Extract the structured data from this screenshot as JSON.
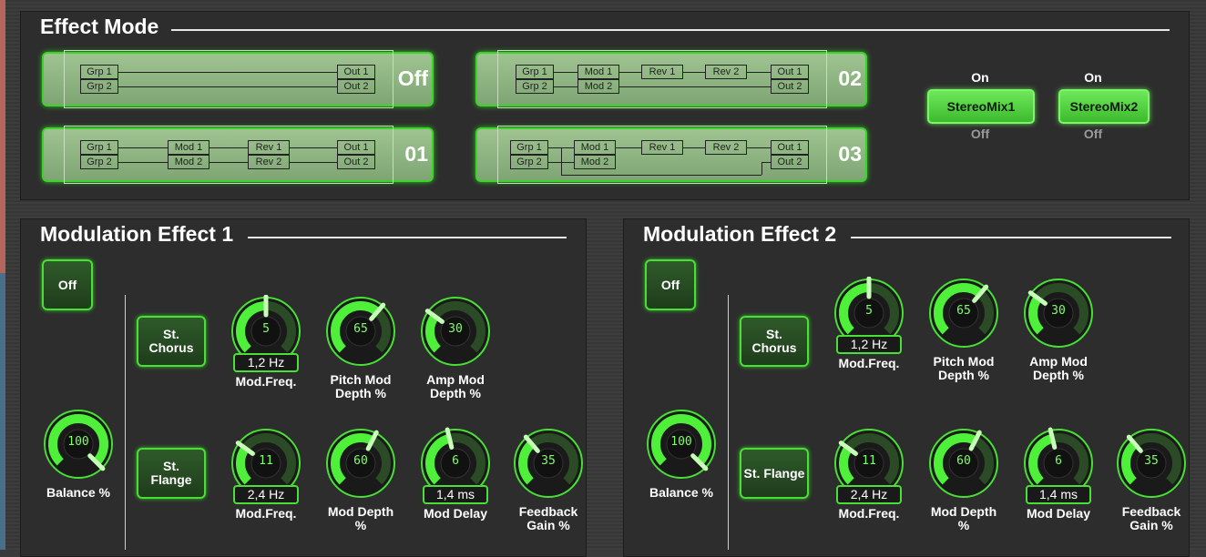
{
  "effect_mode": {
    "title": "Effect Mode",
    "routes": [
      {
        "id": "off",
        "label": "Off"
      },
      {
        "id": "02",
        "label": "02"
      },
      {
        "id": "01",
        "label": "01"
      },
      {
        "id": "03",
        "label": "03"
      }
    ],
    "box_labels": {
      "grp1": "Grp 1",
      "grp2": "Grp 2",
      "out1": "Out 1",
      "out2": "Out 2",
      "mod1": "Mod 1",
      "mod2": "Mod 2",
      "rev1": "Rev 1",
      "rev2": "Rev 2"
    },
    "stereo": [
      {
        "label": "StereoMix1",
        "on": "On",
        "off": "Off"
      },
      {
        "label": "StereoMix2",
        "on": "On",
        "off": "Off"
      }
    ]
  },
  "mod1": {
    "title": "Modulation Effect 1",
    "off_button": "Off",
    "chorus_button": "St.\nChorus",
    "flange_button": "St.\nFlange",
    "balance": {
      "value": "100",
      "label": "Balance %",
      "level": 1.0
    },
    "chorus_knobs": [
      {
        "value": "5",
        "label": "Mod.Freq.",
        "readout": "1,2 Hz",
        "level": 0.5
      },
      {
        "value": "65",
        "label": "Pitch Mod\nDepth %",
        "level": 0.65
      },
      {
        "value": "30",
        "label": "Amp Mod\nDepth %",
        "level": 0.3
      }
    ],
    "flange_knobs": [
      {
        "value": "11",
        "label": "Mod.Freq.",
        "readout": "2,4 Hz",
        "level": 0.3
      },
      {
        "value": "60",
        "label": "Mod Depth\n%",
        "level": 0.6
      },
      {
        "value": "6",
        "label": "Mod Delay",
        "readout": "1,4 ms",
        "level": 0.45
      },
      {
        "value": "35",
        "label": "Feedback\nGain %",
        "level": 0.35
      }
    ]
  },
  "mod2": {
    "title": "Modulation Effect 2",
    "off_button": "Off",
    "chorus_button": "St.\nChorus",
    "flange_button": "St. Flange",
    "balance": {
      "value": "100",
      "label": "Balance %",
      "level": 1.0
    },
    "chorus_knobs": [
      {
        "value": "5",
        "label": "Mod.Freq.",
        "readout": "1,2 Hz",
        "level": 0.5
      },
      {
        "value": "65",
        "label": "Pitch Mod\nDepth %",
        "level": 0.65
      },
      {
        "value": "30",
        "label": "Amp Mod\nDepth %",
        "level": 0.3
      }
    ],
    "flange_knobs": [
      {
        "value": "11",
        "label": "Mod.Freq.",
        "readout": "2,4 Hz",
        "level": 0.3
      },
      {
        "value": "60",
        "label": "Mod Depth\n%",
        "level": 0.6
      },
      {
        "value": "6",
        "label": "Mod Delay",
        "readout": "1,4 ms",
        "level": 0.45
      },
      {
        "value": "35",
        "label": "Feedback\nGain %",
        "level": 0.35
      }
    ]
  },
  "colors": {
    "accent": "#48e035",
    "panel": "#2d2d2d",
    "route_fill": "#8fb682"
  }
}
